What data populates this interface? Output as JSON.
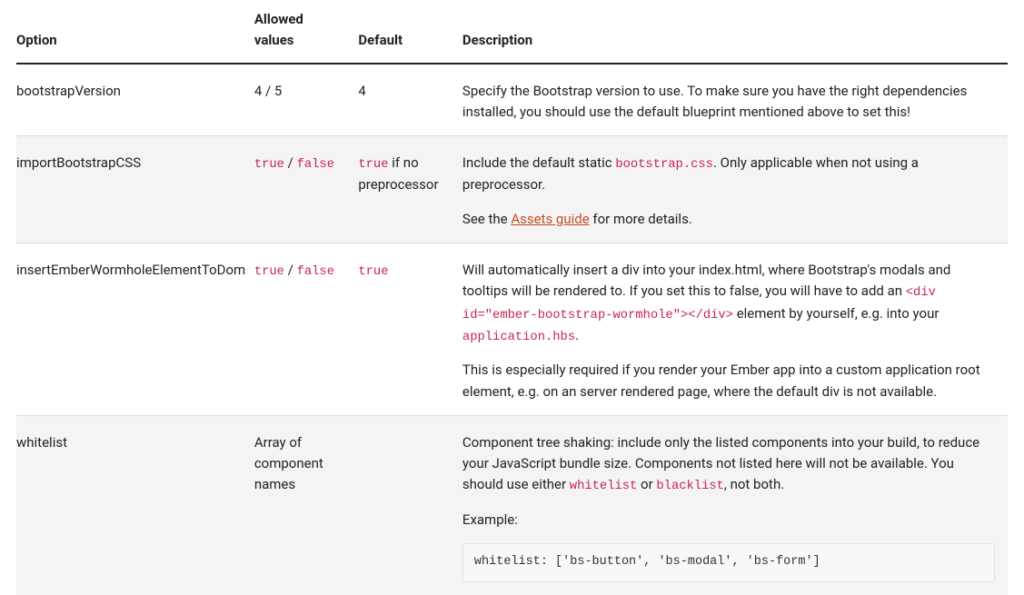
{
  "headers": {
    "option": "Option",
    "allowed": "Allowed values",
    "default": "Default",
    "description": "Description"
  },
  "rows": [
    {
      "option": "bootstrapVersion",
      "allowed_plain": "4 / 5",
      "default_plain": "4",
      "desc": [
        {
          "type": "p_text",
          "text": "Specify the Bootstrap version to use. To make sure you have the right dependencies installed, you should use the default blueprint mentioned above to set this!"
        }
      ],
      "shaded": false
    },
    {
      "option": "importBootstrapCSS",
      "allowed_codes": [
        "true",
        "false"
      ],
      "default_mixed": {
        "code": "true",
        "after": " if no preprocessor"
      },
      "desc": [
        {
          "type": "p_mixed",
          "before": "Include the default static ",
          "code": "bootstrap.css",
          "after": ". Only applicable when not using a preprocessor."
        },
        {
          "type": "p_link",
          "before": "See the ",
          "link_text": "Assets guide",
          "after": " for more details."
        }
      ],
      "shaded": true
    },
    {
      "option": "insertEmberWormholeElementToDom",
      "allowed_codes": [
        "true",
        "false"
      ],
      "default_code": "true",
      "desc": [
        {
          "type": "p_two_codes",
          "t0": "Will automatically insert a div into your index.html, where Bootstrap's modals and tooltips will be rendered to. If you set this to false, you will have to add an ",
          "c0": "<div id=\"ember-bootstrap-wormhole\"></div>",
          "t1": " element by yourself, e.g. into your ",
          "c1": "application.hbs",
          "t2": "."
        },
        {
          "type": "p_text",
          "text": "This is especially required if you render your Ember app into a custom application root element, e.g. on an server rendered page, where the default div is not available."
        }
      ],
      "shaded": false
    },
    {
      "option": "whitelist",
      "allowed_plain": "Array of component names",
      "default_plain": "",
      "desc": [
        {
          "type": "p_two_codes",
          "t0": "Component tree shaking: include only the listed components into your build, to reduce your JavaScript bundle size. Components not listed here will not be available. You should use either ",
          "c0": "whitelist",
          "t1": " or ",
          "c1": "blacklist",
          "t2": ", not both."
        },
        {
          "type": "p_text",
          "text": "Example:"
        },
        {
          "type": "pre",
          "text": "whitelist: ['bs-button', 'bs-modal', 'bs-form']"
        }
      ],
      "shaded": true
    }
  ]
}
